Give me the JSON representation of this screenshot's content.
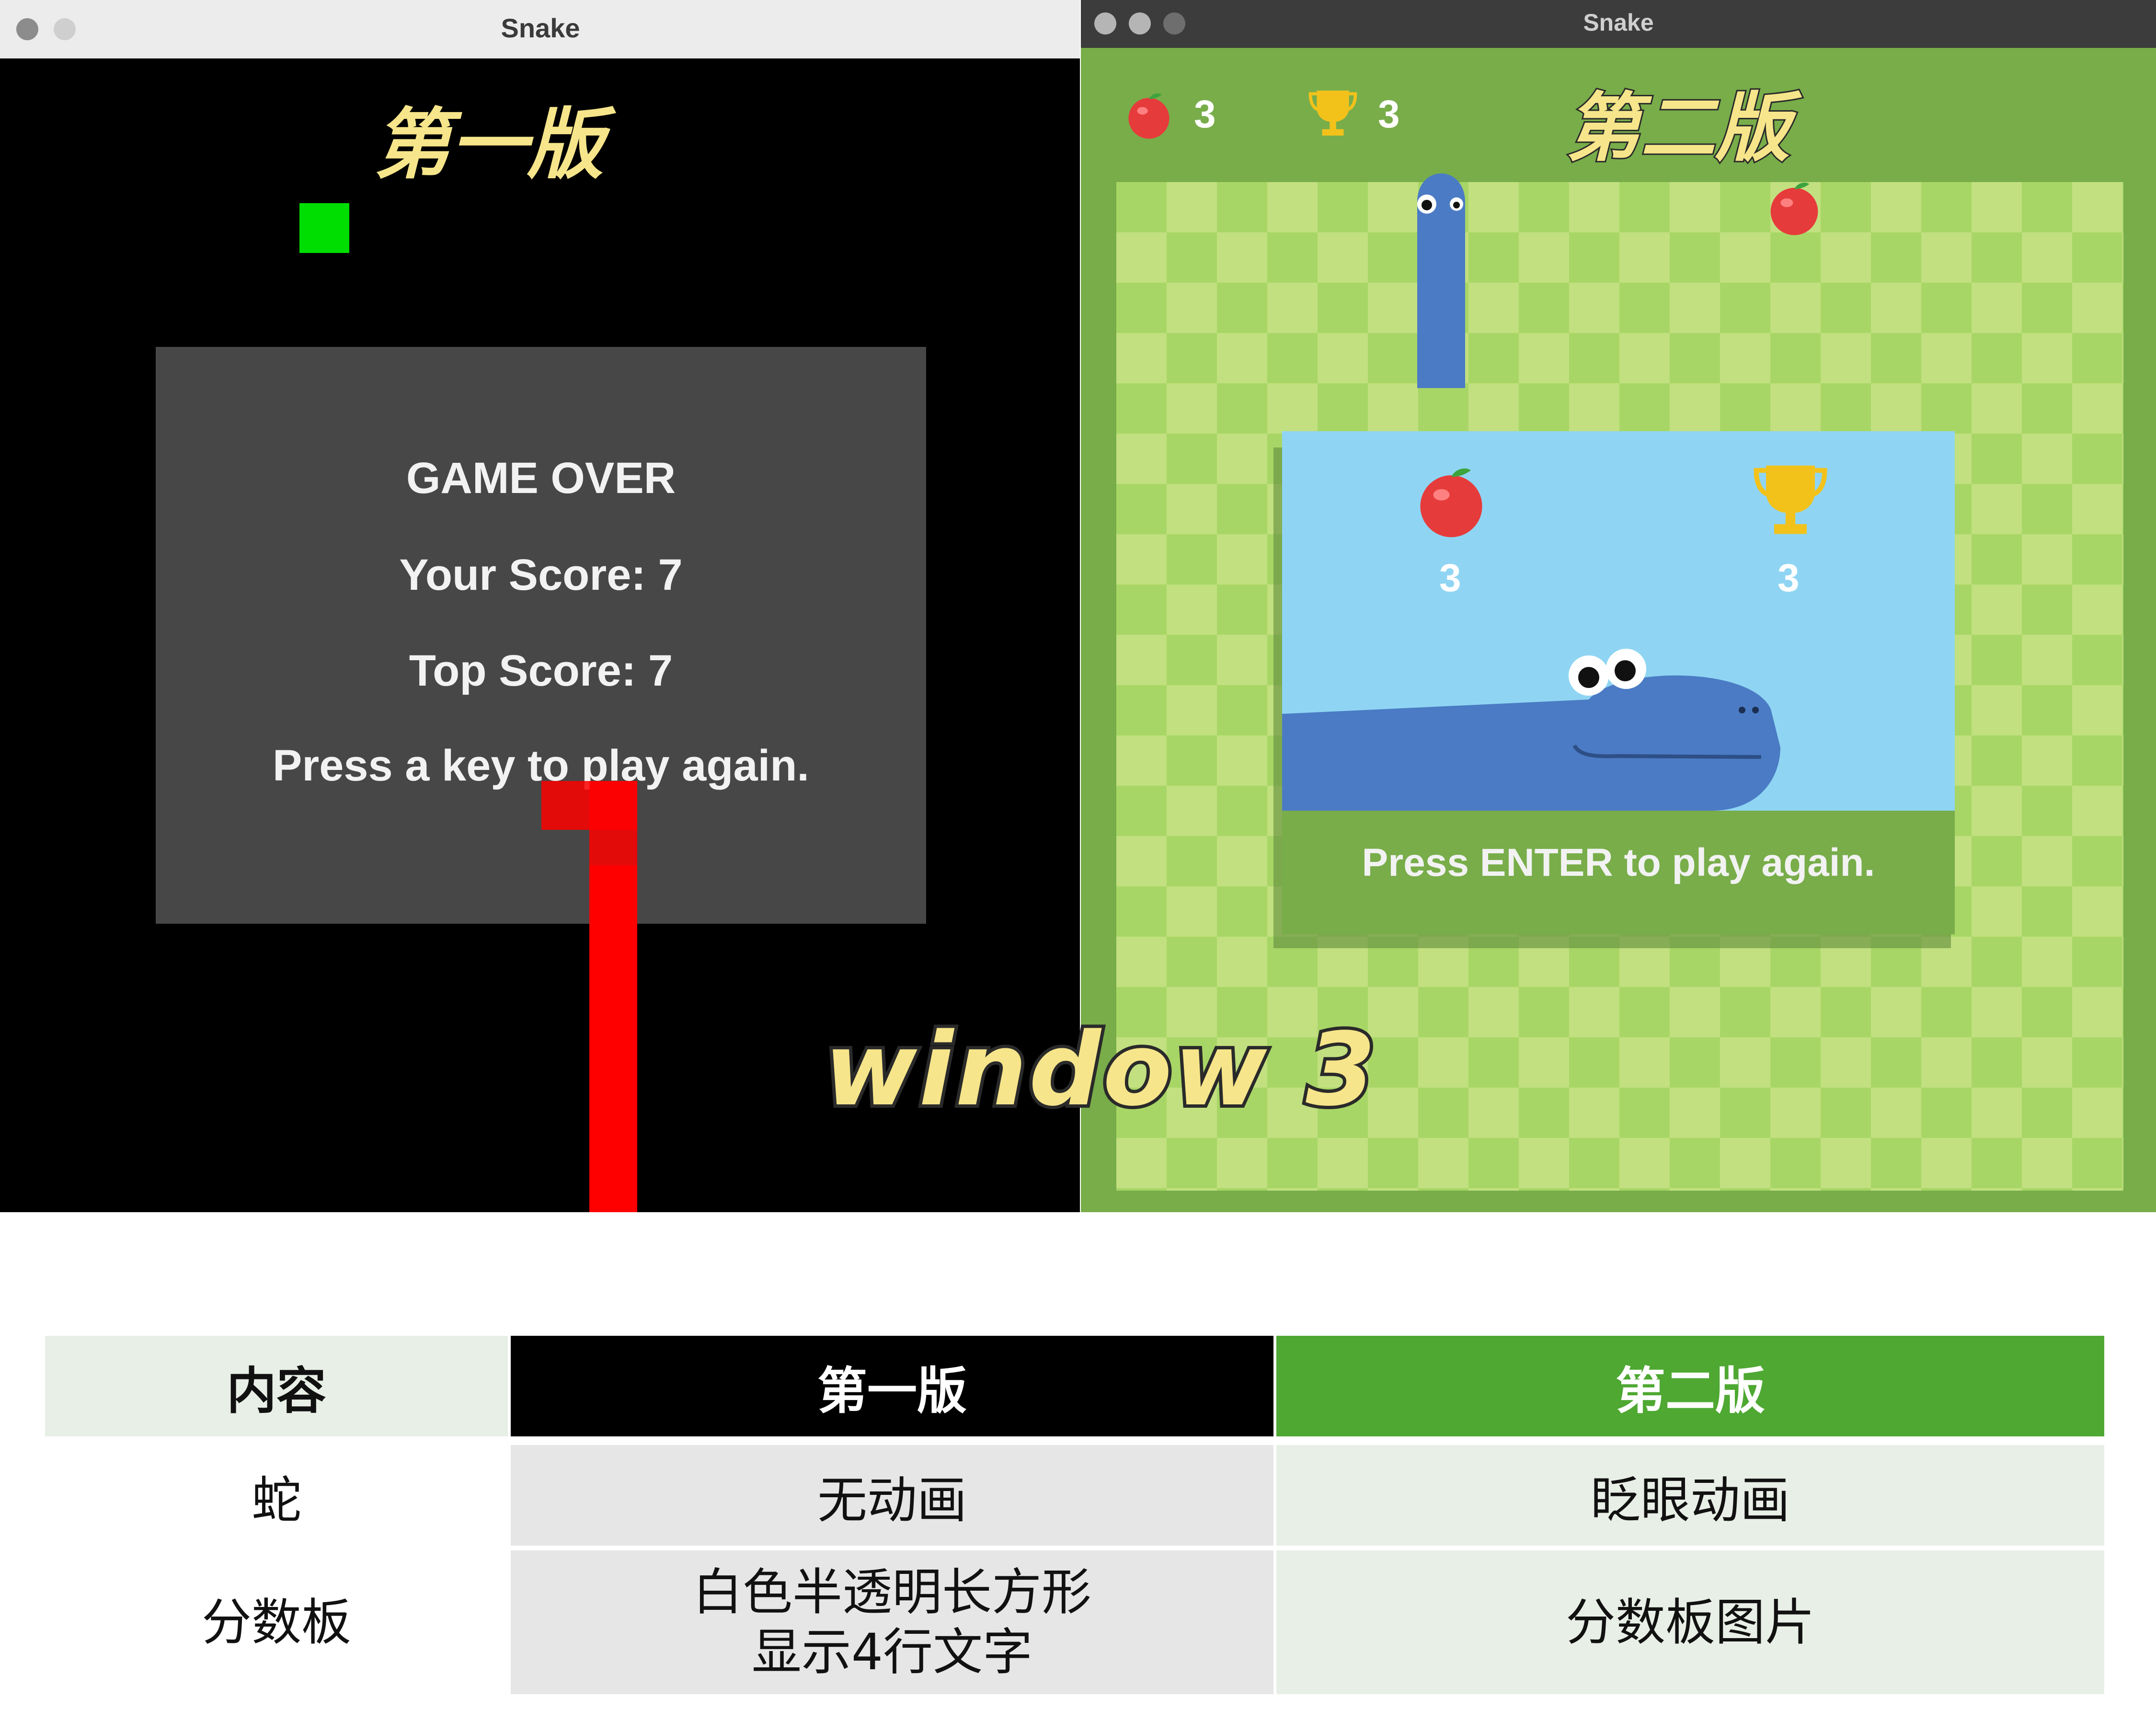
{
  "window1": {
    "title": "Snake",
    "version_label": "第一版",
    "game_over": {
      "heading": "GAME OVER",
      "your_score": "Your Score: 7",
      "top_score": "Top Score: 7",
      "prompt": "Press a key to play again."
    },
    "colors": {
      "food": "#00dd00",
      "snake": "#ff0000",
      "overlay": "#474747"
    }
  },
  "window2": {
    "title": "Snake",
    "version_label": "第二版",
    "hud": {
      "apple_count": "3",
      "trophy_count": "3"
    },
    "panel": {
      "apple_score": "3",
      "trophy_score": "3",
      "prompt": "Press ENTER to play again."
    },
    "colors": {
      "snake": "#4b7bc4",
      "board_light": "#c2e080",
      "board_dark": "#a8d666",
      "frame": "#78ad4a",
      "panel": "#8fd5f3"
    }
  },
  "overlay_label": "window 3",
  "comparison_table": {
    "headers": [
      "内容",
      "第一版",
      "第二版"
    ],
    "rows": [
      {
        "item": "蛇",
        "v1": "无动画",
        "v2": "眨眼动画"
      },
      {
        "item": "分数板",
        "v1_line1": "白色半透明长方形",
        "v1_line2": "显示4行文字",
        "v2": "分数板图片"
      }
    ],
    "colors": {
      "header_item": "#e8efe6",
      "header_v1": "#000000",
      "header_v2": "#4ea832",
      "cell_v1": "#e6e6e6",
      "cell_v2": "#e8efe6"
    }
  }
}
